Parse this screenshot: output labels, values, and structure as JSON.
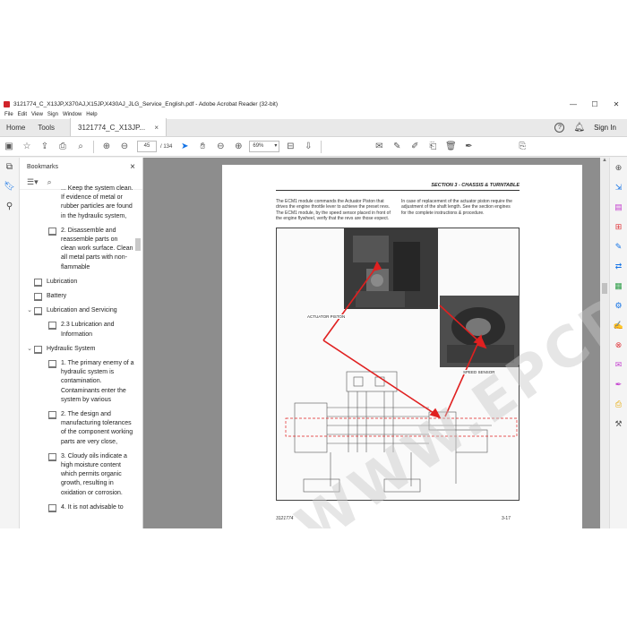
{
  "window": {
    "title": "3121774_C_X13JP,X370AJ,X15JP,X430AJ_JLG_Service_English.pdf - Adobe Acrobat Reader (32-bit)",
    "minimize": "—",
    "maximize": "☐",
    "close": "✕"
  },
  "menu": [
    "File",
    "Edit",
    "View",
    "Sign",
    "Window",
    "Help"
  ],
  "tabs": {
    "home": "Home",
    "tools": "Tools",
    "doc": "3121774_C_X13JP...",
    "doc_close": "×",
    "help_icon": "?",
    "sign_in": "Sign In"
  },
  "toolbar": {
    "page_current": "45",
    "page_total": "/ 134",
    "zoom": "69%"
  },
  "bookmarks": {
    "title": "Bookmarks",
    "close": "×",
    "items": [
      {
        "level": 1,
        "chev": "",
        "icon": false,
        "text": "... Keep the system clean. If evidence of metal or rubber particles are found in the hydraulic system,"
      },
      {
        "level": 1,
        "chev": "",
        "icon": true,
        "text": "2. Disassemble and reassemble parts on clean work surface. Clean all metal parts with non-flammable"
      },
      {
        "level": 0,
        "chev": "",
        "icon": true,
        "text": "Lubrication"
      },
      {
        "level": 0,
        "chev": "",
        "icon": true,
        "text": "Battery"
      },
      {
        "level": 0,
        "chev": "⌄",
        "icon": true,
        "text": "Lubrication and Servicing"
      },
      {
        "level": 1,
        "chev": "",
        "icon": true,
        "text": "2.3 Lubrication and Information"
      },
      {
        "level": 0,
        "chev": "⌄",
        "icon": true,
        "text": "Hydraulic System"
      },
      {
        "level": 1,
        "chev": "",
        "icon": true,
        "text": "1. The primary enemy of a hydraulic system is contamination. Contaminants enter the system by various"
      },
      {
        "level": 1,
        "chev": "",
        "icon": true,
        "text": "2. The design and manufacturing tolerances of the component working parts are very close,"
      },
      {
        "level": 1,
        "chev": "",
        "icon": true,
        "text": "3. Cloudy oils indicate a high moisture content which permits organic growth, resulting in oxidation or corrosion."
      },
      {
        "level": 1,
        "chev": "",
        "icon": true,
        "text": "4. It is not advisable to"
      }
    ]
  },
  "page": {
    "section_title": "SECTION 3 - CHASSIS & TURNTABLE",
    "para_left": "The ECM1 module commands the Actuator Piston that drives the engine throttle lever to achieve the preset revs. The ECM1 module, by the speed sensor placed in front of the engine flywheel, verify that the revs are those expect.",
    "para_right": "In case of replacement of the actuator piston require the adjustment of the shaft length. See the section engines for the complete instructions & procedure.",
    "label_actuator": "ACTUATOR PISTON",
    "label_speed": "SPEED SENSOR",
    "footer_left": "3121774",
    "footer_right": "3-17",
    "watermark": "WWW.EPCDATA.COM"
  },
  "colors": {
    "accent": "#1473e6",
    "arrow_red": "#e02020",
    "acrobat_red": "#d1232a"
  }
}
